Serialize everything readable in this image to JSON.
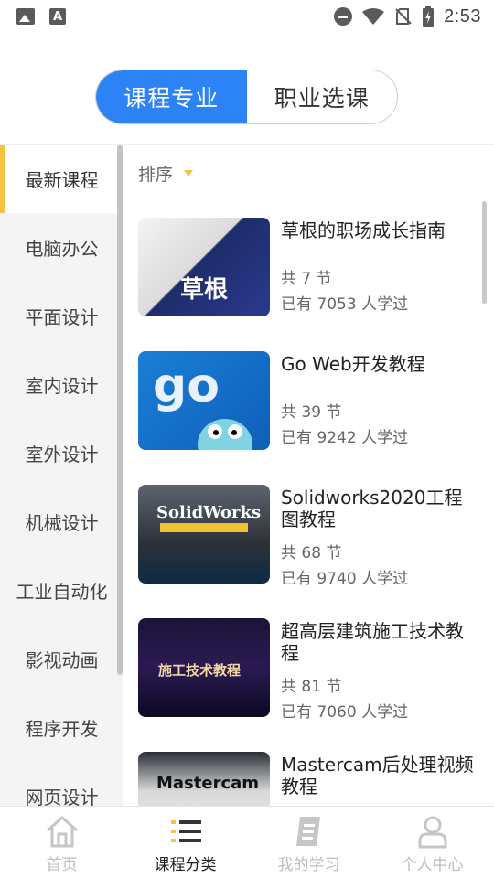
{
  "status_bar": {
    "time": "2:53",
    "a_icon_label": "A"
  },
  "top_tabs": [
    {
      "label": "课程专业",
      "active": true
    },
    {
      "label": "职业选课",
      "active": false
    }
  ],
  "sidebar": {
    "items": [
      {
        "label": "最新课程",
        "active": true
      },
      {
        "label": "电脑办公"
      },
      {
        "label": "平面设计"
      },
      {
        "label": "室内设计"
      },
      {
        "label": "室外设计"
      },
      {
        "label": "机械设计"
      },
      {
        "label": "工业自动化"
      },
      {
        "label": "影视动画"
      },
      {
        "label": "程序开发"
      },
      {
        "label": "网页设计"
      }
    ]
  },
  "sort": {
    "label": "排序"
  },
  "courses": [
    {
      "title": "草根的职场成长指南",
      "lessons": "共 7 节",
      "learners": "已有  7053 人学过",
      "thumb_text": "草根"
    },
    {
      "title": "Go Web开发教程",
      "lessons": "共 39 节",
      "learners": "已有  9242 人学过",
      "thumb_text": "go"
    },
    {
      "title": "Solidworks2020工程图教程",
      "lessons": "共 68 节",
      "learners": "已有  9740 人学过",
      "thumb_text": "SolidWorks"
    },
    {
      "title": "超高层建筑施工技术教程",
      "lessons": "共 81 节",
      "learners": "已有  7060 人学过",
      "thumb_text": "施工技术教程"
    },
    {
      "title": "Mastercam后处理视频教程",
      "lessons": "",
      "learners": "",
      "thumb_text": "Mastercam"
    }
  ],
  "bottom_nav": [
    {
      "label": "首页",
      "icon": "home-icon",
      "active": false
    },
    {
      "label": "课程分类",
      "icon": "list-icon",
      "active": true
    },
    {
      "label": "我的学习",
      "icon": "notebook-icon",
      "active": false
    },
    {
      "label": "个人中心",
      "icon": "person-icon",
      "active": false
    }
  ],
  "colors": {
    "accent": "#2b83f6",
    "sidebar_marker": "#f6c343"
  }
}
